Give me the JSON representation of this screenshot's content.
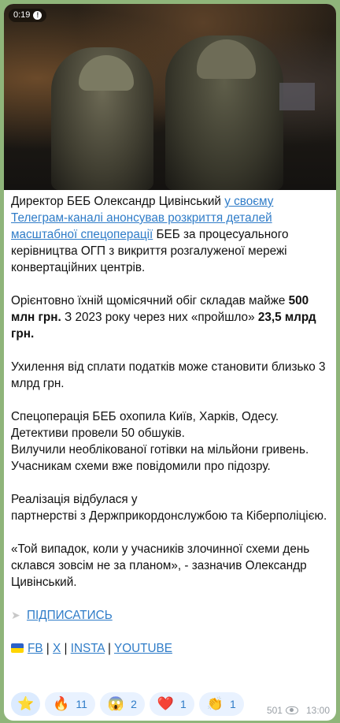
{
  "video": {
    "duration": "0:19"
  },
  "post": {
    "p1_a": "Директор БЕБ Олександр Цивінський ",
    "p1_link": "у своєму Телеграм-каналі анонсував розкриття деталей масштабної спецоперації",
    "p1_b": " БЕБ за процесуального керівництва ОГП з викриття розгалуженої мережі конвертаційних центрів.",
    "p2_a": "Орієнтовно їхній щомісячний обіг складав майже ",
    "p2_bold1": "500 млн грн.",
    "p2_b": " З 2023 року через них «пройшло» ",
    "p2_bold2": "23,5 млрд грн.",
    "p3": "Ухилення від сплати податків може становити близько 3 млрд грн.",
    "p4_l1": "Спецоперація БЕБ охопила Київ, Харків, Одесу.",
    "p4_l2": "Детективи провели 50 обшуків.",
    "p4_l3": "Вилучили необлікованої готівки на мільйони гривень. Учасникам схеми вже повідомили про підозру.",
    "p5_l1": "Реалізація відбулася у",
    "p5_l2": "партнерстві з Держприкордонслужбою та Кіберполіцією.",
    "p6": "«Той випадок, коли у учасників злочинної схеми день склався зовсім не за планом», - зазначив Олександр Цивінський.",
    "subscribe": "ПІДПИСАТИСЬ",
    "links": {
      "fb": "FB",
      "x": "X",
      "insta": "INSTA",
      "youtube": "YOUTUBE",
      "sep": " | "
    }
  },
  "reactions": [
    {
      "emoji": "⭐",
      "count": ""
    },
    {
      "emoji": "🔥",
      "count": "11"
    },
    {
      "emoji": "😱",
      "count": "2"
    },
    {
      "emoji": "❤️",
      "count": "1"
    },
    {
      "emoji": "👏",
      "count": "1"
    }
  ],
  "meta": {
    "views": "501",
    "time": "13:00"
  }
}
